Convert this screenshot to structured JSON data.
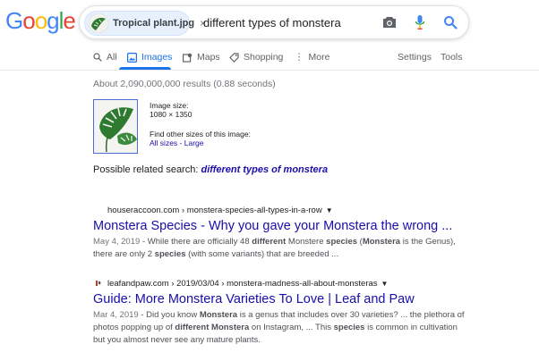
{
  "logo": {
    "text": "Google"
  },
  "search": {
    "chip_label": "Tropical plant.jpg",
    "chip_close": "×",
    "query": "different types of monstera"
  },
  "tabs": {
    "all": "All",
    "images": "Images",
    "maps": "Maps",
    "shopping": "Shopping",
    "more": "More",
    "settings": "Settings",
    "tools": "Tools"
  },
  "results_stats": "About 2,090,000,000 results (0.88 seconds)",
  "image_info": {
    "size_label": "Image size:",
    "size_value": "1080 × 1350",
    "find_label": "Find other sizes of this image:",
    "all_sizes": "All sizes",
    "separator": " - ",
    "large": "Large"
  },
  "related": {
    "label": "Possible related search:",
    "query": "different types of monstera"
  },
  "results": [
    {
      "url": "houseraccoon.com › monstera-species-all-types-in-a-row",
      "title": "Monstera Species - Why you gave your Monstera the wrong ...",
      "date": "May 4, 2019",
      "snippet_parts": [
        " - While there are officially 48 ",
        "different",
        " Monstere ",
        "species",
        " (",
        "Monstera",
        " is the Genus), there are only 2 ",
        "species",
        " (with some variants) that are breeded ..."
      ]
    },
    {
      "url": "leafandpaw.com › 2019/03/04 › monstera-madness-all-about-monsteras",
      "title": "Guide: More Monstera Varieties To Love | Leaf and Paw",
      "date": "Mar 4, 2019",
      "snippet_parts": [
        " - Did you know ",
        "Monstera",
        " is a genus that includes over 30 varieties? ... the plethora of photos popping up of ",
        "different Monstera",
        " on Instagram, ... This ",
        "species",
        " is common in cultivation but you almost never see any mature plants."
      ]
    }
  ],
  "colors": {
    "link": "#1a0dab",
    "accent": "#1a73e8"
  }
}
